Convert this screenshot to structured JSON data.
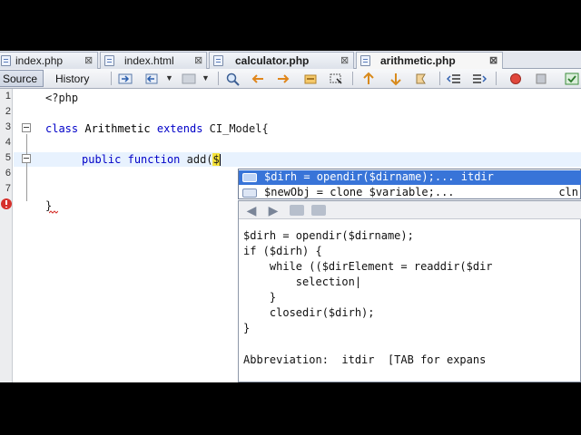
{
  "tabs": [
    {
      "label": "index.php",
      "close": "⊠"
    },
    {
      "label": "index.html",
      "close": "⊠"
    },
    {
      "label": "calculator.php",
      "close": "⊠"
    },
    {
      "label": "arithmetic.php",
      "close": "⊠"
    }
  ],
  "toolbar": {
    "source_label": "Source",
    "history_label": "History"
  },
  "editor": {
    "line_numbers": [
      "1",
      "2",
      "3",
      "4",
      "5",
      "6",
      "7",
      "8"
    ],
    "code": {
      "line1": "<?php",
      "line3_keyword1": "class",
      "line3_name": "Arithmetic",
      "line3_keyword2": "extends",
      "line3_base": "CI_Model{",
      "line5_keyword1": "public",
      "line5_keyword2": "function",
      "line5_fn": "add($",
      "line8": "}"
    }
  },
  "completion": {
    "items": [
      {
        "text": "$dirh = opendir($dirname);... itdir",
        "right": ""
      },
      {
        "text": "$newObj = clone $variable;...",
        "right": "cln"
      }
    ]
  },
  "documentation": {
    "lines": [
      "$dirh = opendir($dirname);",
      "if ($dirh) {",
      "    while (($dirElement = readdir($dir",
      "        selection|",
      "    }",
      "    closedir($dirh);",
      "}"
    ],
    "footer": "Abbreviation:  itdir  [TAB for expans"
  },
  "colors": {
    "accent": "#3874d8",
    "keyword": "#0000c8",
    "error": "#d6312c"
  }
}
